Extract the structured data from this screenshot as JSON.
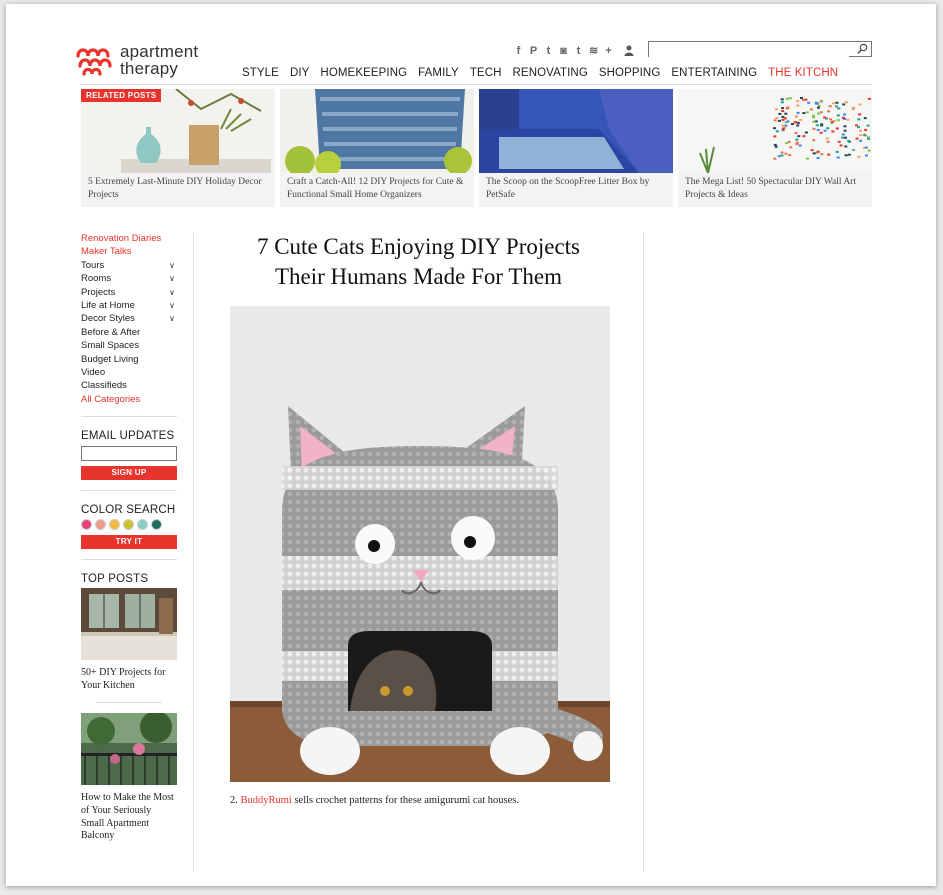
{
  "header": {
    "logo_line1": "apartment",
    "logo_line2": "therapy",
    "social_icons": [
      "facebook-icon",
      "pinterest-icon",
      "twitter-icon",
      "instagram-icon",
      "tumblr-icon",
      "rss-icon",
      "plus-icon"
    ],
    "social_glyphs": [
      "f",
      "P",
      "t",
      "◙",
      "t",
      "≋",
      "+"
    ],
    "search_placeholder": "",
    "nav": [
      {
        "label": "STYLE"
      },
      {
        "label": "DIY"
      },
      {
        "label": "HOMEKEEPING"
      },
      {
        "label": "FAMILY"
      },
      {
        "label": "TECH"
      },
      {
        "label": "RENOVATING"
      },
      {
        "label": "SHOPPING"
      },
      {
        "label": "ENTERTAINING"
      },
      {
        "label": "THE KITCHN"
      }
    ],
    "accent_color": "#e8342d"
  },
  "related": {
    "tag": "RELATED POSTS",
    "items": [
      {
        "caption": "5 Extremely Last-Minute DIY Holiday Decor Projects"
      },
      {
        "caption": "Craft a Catch-All! 12 DIY Projects for Cute & Functional Small Home Organizers"
      },
      {
        "caption": "The Scoop on the ScoopFree Litter Box by PetSafe"
      },
      {
        "caption": "The Mega List! 50 Spectacular DIY Wall Art Projects & Ideas"
      }
    ],
    "next_arrow": "›"
  },
  "sidebar": {
    "links": [
      {
        "label": "Renovation Diaries",
        "red": true,
        "expand": false
      },
      {
        "label": "Maker Talks",
        "red": true,
        "expand": false
      },
      {
        "label": "Tours",
        "red": false,
        "expand": true
      },
      {
        "label": "Rooms",
        "red": false,
        "expand": true
      },
      {
        "label": "Projects",
        "red": false,
        "expand": true
      },
      {
        "label": "Life at Home",
        "red": false,
        "expand": true
      },
      {
        "label": "Decor Styles",
        "red": false,
        "expand": true
      },
      {
        "label": "Before & After",
        "red": false,
        "expand": false
      },
      {
        "label": "Small Spaces",
        "red": false,
        "expand": false
      },
      {
        "label": "Budget Living",
        "red": false,
        "expand": false
      },
      {
        "label": "Video",
        "red": false,
        "expand": false
      },
      {
        "label": "Classifieds",
        "red": false,
        "expand": false
      },
      {
        "label": "All Categories",
        "red": true,
        "expand": false
      }
    ],
    "chevron": "∨",
    "email_heading": "EMAIL UPDATES",
    "signup_label": "SIGN UP",
    "color_heading": "COLOR SEARCH",
    "swatch_colors": [
      "#e8417a",
      "#f29a8a",
      "#f4b93a",
      "#c9c22a",
      "#86cfc4",
      "#1f6b5c"
    ],
    "try_label": "TRY IT",
    "top_heading": "TOP POSTS",
    "top_posts": [
      {
        "caption": "50+ DIY Projects for Your Kitchen"
      },
      {
        "caption": "How to Make the Most of Your Seriously Small Apartment Balcony"
      }
    ]
  },
  "article": {
    "title_line1": "7 Cute Cats Enjoying DIY Projects",
    "title_line2": "Their Humans Made For Them",
    "caption_num": "2.",
    "caption_link": "BuddyRumi",
    "caption_rest": "sells crochet patterns for these amigurumi cat houses."
  }
}
